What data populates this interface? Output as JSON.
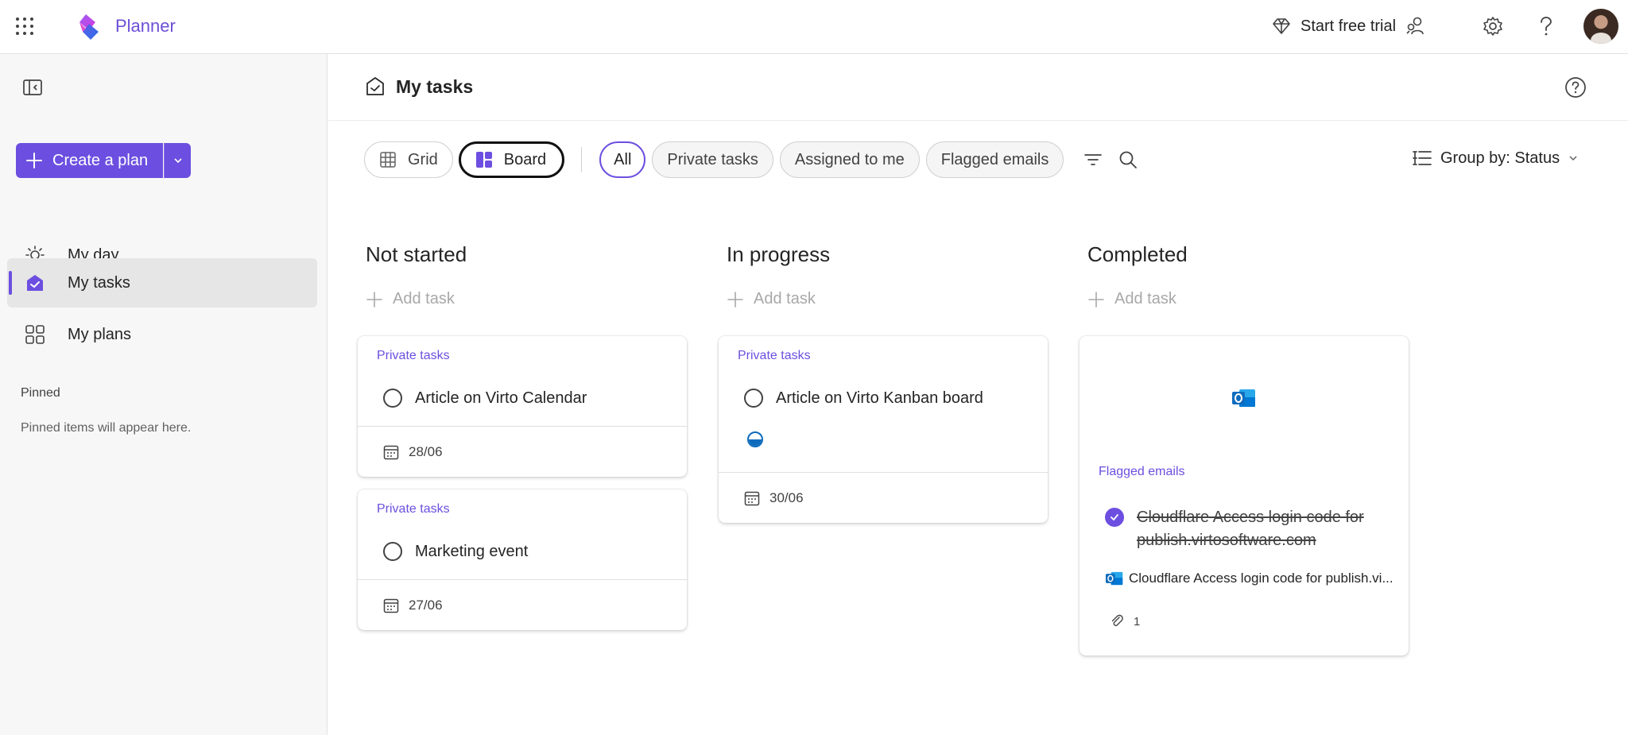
{
  "app": {
    "name": "Planner",
    "trial_label": "Start free trial"
  },
  "colors": {
    "accent": "#6c4fe0",
    "outlook_blue": "#0f6cbd"
  },
  "icons": {
    "waffle": "app-launcher-icon",
    "trial": "diamond-icon",
    "share": "people-share-icon",
    "settings": "gear-icon",
    "help": "question-icon"
  },
  "sidebar": {
    "create_label": "Create a plan",
    "items": [
      {
        "label": "My day",
        "icon": "sun-icon"
      },
      {
        "label": "My tasks",
        "icon": "tasks-icon",
        "active": true
      },
      {
        "label": "My plans",
        "icon": "grid-icon"
      }
    ],
    "pinned_title": "Pinned",
    "pinned_empty": "Pinned items will appear here."
  },
  "page": {
    "title": "My tasks"
  },
  "toolbar": {
    "views": [
      {
        "label": "Grid",
        "selected": false
      },
      {
        "label": "Board",
        "selected": true
      }
    ],
    "filters": [
      {
        "label": "All",
        "selected": true
      },
      {
        "label": "Private tasks",
        "selected": false
      },
      {
        "label": "Assigned to me",
        "selected": false
      },
      {
        "label": "Flagged emails",
        "selected": false
      }
    ],
    "group_by": "Group by: Status"
  },
  "board": {
    "add_task_label": "Add task",
    "columns": [
      {
        "title": "Not started",
        "cards": [
          {
            "plan": "Private tasks",
            "task": "Article on Virto Calendar",
            "date": "28/06"
          },
          {
            "plan": "Private tasks",
            "task": "Marketing event",
            "date": "27/06"
          }
        ]
      },
      {
        "title": "In progress",
        "cards": [
          {
            "plan": "Private tasks",
            "task": "Article on Virto Kanban board",
            "date": "30/06",
            "progress": "in progress"
          }
        ]
      },
      {
        "title": "Completed",
        "cards": [
          {
            "plan": "Flagged emails",
            "task": "Cloudflare Access login code for publish.virtosoftware.com",
            "email_subject": "Cloudflare Access login code for publish.vi...",
            "attachments": "1"
          }
        ]
      }
    ]
  }
}
